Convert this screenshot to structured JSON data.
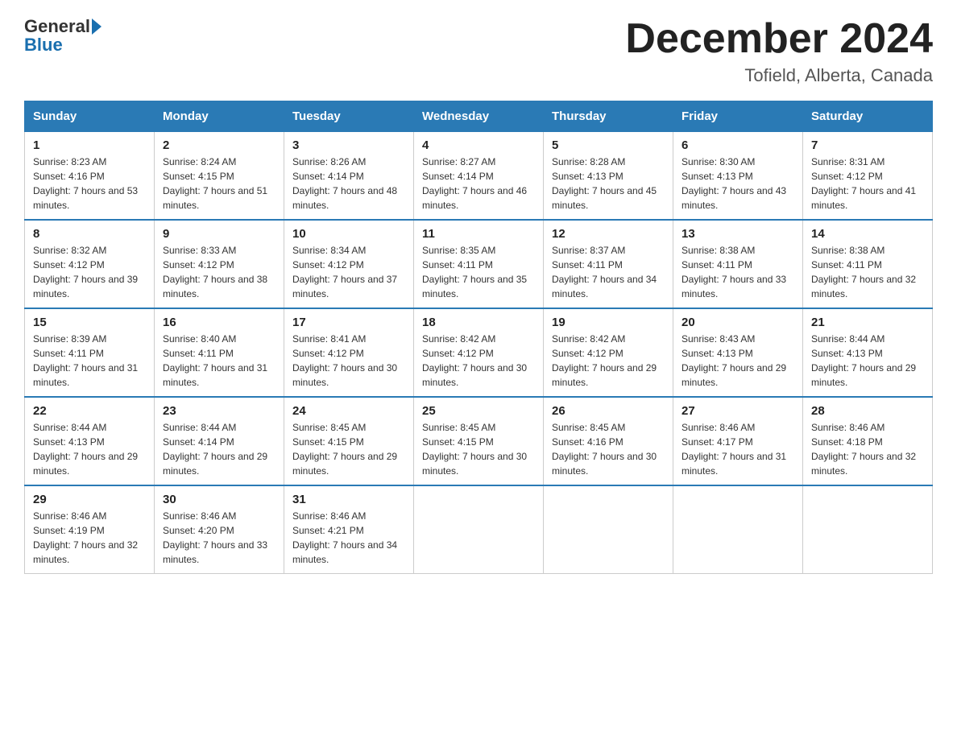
{
  "header": {
    "logo_line1": "General",
    "logo_line2": "Blue",
    "month_title": "December 2024",
    "location": "Tofield, Alberta, Canada"
  },
  "weekdays": [
    "Sunday",
    "Monday",
    "Tuesday",
    "Wednesday",
    "Thursday",
    "Friday",
    "Saturday"
  ],
  "weeks": [
    [
      {
        "day": "1",
        "sunrise": "8:23 AM",
        "sunset": "4:16 PM",
        "daylight": "7 hours and 53 minutes."
      },
      {
        "day": "2",
        "sunrise": "8:24 AM",
        "sunset": "4:15 PM",
        "daylight": "7 hours and 51 minutes."
      },
      {
        "day": "3",
        "sunrise": "8:26 AM",
        "sunset": "4:14 PM",
        "daylight": "7 hours and 48 minutes."
      },
      {
        "day": "4",
        "sunrise": "8:27 AM",
        "sunset": "4:14 PM",
        "daylight": "7 hours and 46 minutes."
      },
      {
        "day": "5",
        "sunrise": "8:28 AM",
        "sunset": "4:13 PM",
        "daylight": "7 hours and 45 minutes."
      },
      {
        "day": "6",
        "sunrise": "8:30 AM",
        "sunset": "4:13 PM",
        "daylight": "7 hours and 43 minutes."
      },
      {
        "day": "7",
        "sunrise": "8:31 AM",
        "sunset": "4:12 PM",
        "daylight": "7 hours and 41 minutes."
      }
    ],
    [
      {
        "day": "8",
        "sunrise": "8:32 AM",
        "sunset": "4:12 PM",
        "daylight": "7 hours and 39 minutes."
      },
      {
        "day": "9",
        "sunrise": "8:33 AM",
        "sunset": "4:12 PM",
        "daylight": "7 hours and 38 minutes."
      },
      {
        "day": "10",
        "sunrise": "8:34 AM",
        "sunset": "4:12 PM",
        "daylight": "7 hours and 37 minutes."
      },
      {
        "day": "11",
        "sunrise": "8:35 AM",
        "sunset": "4:11 PM",
        "daylight": "7 hours and 35 minutes."
      },
      {
        "day": "12",
        "sunrise": "8:37 AM",
        "sunset": "4:11 PM",
        "daylight": "7 hours and 34 minutes."
      },
      {
        "day": "13",
        "sunrise": "8:38 AM",
        "sunset": "4:11 PM",
        "daylight": "7 hours and 33 minutes."
      },
      {
        "day": "14",
        "sunrise": "8:38 AM",
        "sunset": "4:11 PM",
        "daylight": "7 hours and 32 minutes."
      }
    ],
    [
      {
        "day": "15",
        "sunrise": "8:39 AM",
        "sunset": "4:11 PM",
        "daylight": "7 hours and 31 minutes."
      },
      {
        "day": "16",
        "sunrise": "8:40 AM",
        "sunset": "4:11 PM",
        "daylight": "7 hours and 31 minutes."
      },
      {
        "day": "17",
        "sunrise": "8:41 AM",
        "sunset": "4:12 PM",
        "daylight": "7 hours and 30 minutes."
      },
      {
        "day": "18",
        "sunrise": "8:42 AM",
        "sunset": "4:12 PM",
        "daylight": "7 hours and 30 minutes."
      },
      {
        "day": "19",
        "sunrise": "8:42 AM",
        "sunset": "4:12 PM",
        "daylight": "7 hours and 29 minutes."
      },
      {
        "day": "20",
        "sunrise": "8:43 AM",
        "sunset": "4:13 PM",
        "daylight": "7 hours and 29 minutes."
      },
      {
        "day": "21",
        "sunrise": "8:44 AM",
        "sunset": "4:13 PM",
        "daylight": "7 hours and 29 minutes."
      }
    ],
    [
      {
        "day": "22",
        "sunrise": "8:44 AM",
        "sunset": "4:13 PM",
        "daylight": "7 hours and 29 minutes."
      },
      {
        "day": "23",
        "sunrise": "8:44 AM",
        "sunset": "4:14 PM",
        "daylight": "7 hours and 29 minutes."
      },
      {
        "day": "24",
        "sunrise": "8:45 AM",
        "sunset": "4:15 PM",
        "daylight": "7 hours and 29 minutes."
      },
      {
        "day": "25",
        "sunrise": "8:45 AM",
        "sunset": "4:15 PM",
        "daylight": "7 hours and 30 minutes."
      },
      {
        "day": "26",
        "sunrise": "8:45 AM",
        "sunset": "4:16 PM",
        "daylight": "7 hours and 30 minutes."
      },
      {
        "day": "27",
        "sunrise": "8:46 AM",
        "sunset": "4:17 PM",
        "daylight": "7 hours and 31 minutes."
      },
      {
        "day": "28",
        "sunrise": "8:46 AM",
        "sunset": "4:18 PM",
        "daylight": "7 hours and 32 minutes."
      }
    ],
    [
      {
        "day": "29",
        "sunrise": "8:46 AM",
        "sunset": "4:19 PM",
        "daylight": "7 hours and 32 minutes."
      },
      {
        "day": "30",
        "sunrise": "8:46 AM",
        "sunset": "4:20 PM",
        "daylight": "7 hours and 33 minutes."
      },
      {
        "day": "31",
        "sunrise": "8:46 AM",
        "sunset": "4:21 PM",
        "daylight": "7 hours and 34 minutes."
      },
      null,
      null,
      null,
      null
    ]
  ],
  "labels": {
    "sunrise_prefix": "Sunrise: ",
    "sunset_prefix": "Sunset: ",
    "daylight_prefix": "Daylight: "
  }
}
